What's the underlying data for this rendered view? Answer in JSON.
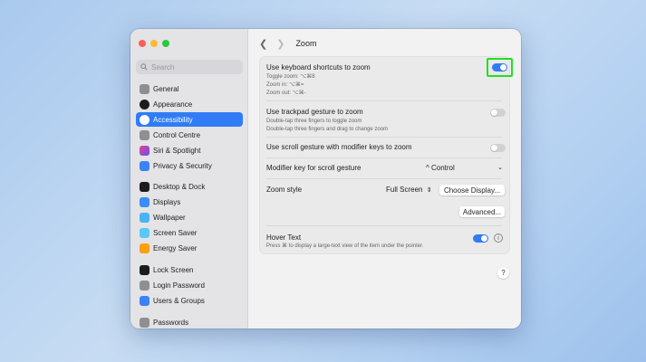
{
  "window": {
    "title": "Zoom"
  },
  "sidebar": {
    "search_placeholder": "Search",
    "items": [
      {
        "label": "General",
        "color": "#8e8e93"
      },
      {
        "label": "Appearance",
        "color": "#1c1c1e"
      },
      {
        "label": "Accessibility",
        "color": "#2f7cf6",
        "active": true
      },
      {
        "label": "Control Centre",
        "color": "#8e8e93"
      },
      {
        "label": "Siri & Spotlight",
        "color": "#c24fd6"
      },
      {
        "label": "Privacy & Security",
        "color": "#3b82f6"
      },
      {
        "label": "Desktop & Dock",
        "color": "#1c1c1e"
      },
      {
        "label": "Displays",
        "color": "#3b8cf6"
      },
      {
        "label": "Wallpaper",
        "color": "#4ab3f4"
      },
      {
        "label": "Screen Saver",
        "color": "#5ac8fa"
      },
      {
        "label": "Energy Saver",
        "color": "#ff9f0a"
      },
      {
        "label": "Lock Screen",
        "color": "#1c1c1e"
      },
      {
        "label": "Login Password",
        "color": "#8e8e93"
      },
      {
        "label": "Users & Groups",
        "color": "#3b82f6"
      },
      {
        "label": "Passwords",
        "color": "#8e8e93"
      }
    ]
  },
  "zoom": {
    "keyboard": {
      "title": "Use keyboard shortcuts to zoom",
      "line1": "Toggle zoom: ⌥⌘8",
      "line2": "Zoom in: ⌥⌘=",
      "line3": "Zoom out: ⌥⌘-",
      "enabled": true
    },
    "trackpad": {
      "title": "Use trackpad gesture to zoom",
      "line1": "Double-tap three fingers to toggle zoom",
      "line2": "Double-tap three fingers and drag to change zoom",
      "enabled": false
    },
    "scroll": {
      "title": "Use scroll gesture with modifier keys to zoom",
      "enabled": false
    },
    "modifier": {
      "label": "Modifier key for scroll gesture",
      "value": "^ Control"
    },
    "style": {
      "label": "Zoom style",
      "value": "Full Screen",
      "choose_display": "Choose Display...",
      "advanced": "Advanced..."
    }
  },
  "hover": {
    "title": "Hover Text",
    "subtitle": "Press ⌘ to display a large-text view of the item under the pointer.",
    "enabled": true
  },
  "help_label": "?",
  "accent_color": "#2f7cf6"
}
